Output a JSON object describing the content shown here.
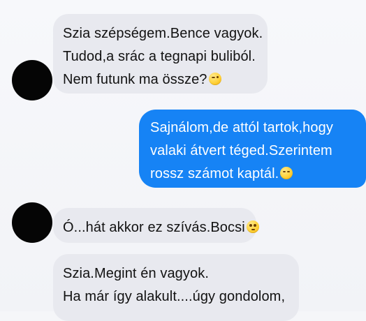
{
  "conversation": {
    "messages": [
      {
        "direction": "incoming",
        "lines": [
          "Szia szépségem.Bence vagyok.",
          "Tudod,a srác a tegnapi buliból.",
          "Nem futunk ma össze?"
        ],
        "emoji": "wink-emoji"
      },
      {
        "direction": "outgoing",
        "lines": [
          "Sajnálom,de attól tartok,hogy",
          "valaki átvert téged.Szerintem",
          "rossz számot kaptál."
        ],
        "emoji": "smirk-emoji"
      },
      {
        "direction": "incoming",
        "lines": [
          "Ó...hát akkor ez szívás.Bocsi"
        ],
        "emoji": "flushed-emoji"
      },
      {
        "direction": "incoming",
        "lines": [
          "Szia.Megint én vagyok.",
          "Ha már így alakult....úgy gondolom,"
        ],
        "emoji": ""
      }
    ]
  },
  "colors": {
    "background": "#f5f6f9",
    "incoming_bubble": "#e8e9ef",
    "outgoing_bubble": "#1683f5",
    "avatar": "#050505"
  }
}
